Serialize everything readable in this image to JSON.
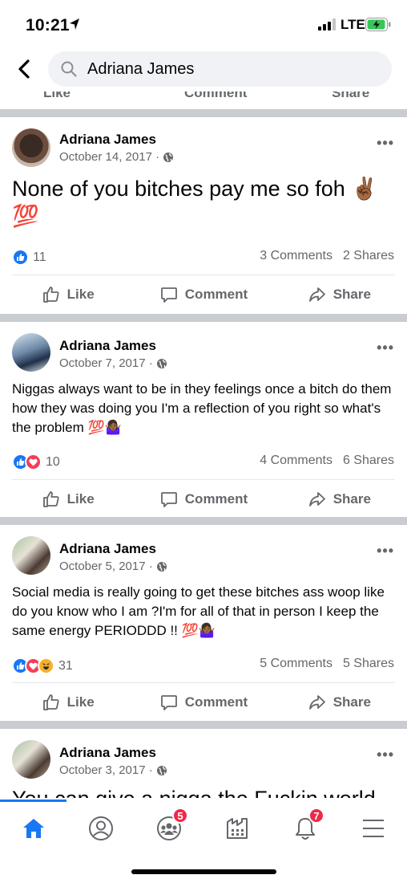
{
  "status_bar": {
    "time": "10:21",
    "network": "LTE"
  },
  "search": {
    "query": "Adriana James"
  },
  "previous_post_actions": {
    "like": "Like",
    "comment": "Comment",
    "share": "Share"
  },
  "posts": [
    {
      "author": "Adriana James",
      "date": "October 14, 2017 ·",
      "text": "None of you bitches pay me so foh ✌🏾 💯",
      "reaction_count": "11",
      "comments": "3 Comments",
      "shares": "2 Shares",
      "actions": {
        "like": "Like",
        "comment": "Comment",
        "share": "Share"
      }
    },
    {
      "author": "Adriana James",
      "date": "October 7, 2017 ·",
      "text": "Niggas always want to be in they feelings once a bitch do them how they was doing you I'm a reflection of you right so what's the problem 💯🤷🏾‍♀️",
      "reaction_count": "10",
      "comments": "4 Comments",
      "shares": "6 Shares",
      "actions": {
        "like": "Like",
        "comment": "Comment",
        "share": "Share"
      }
    },
    {
      "author": "Adriana James",
      "date": "October 5, 2017 ·",
      "text": "Social media is really going to get these bitches ass woop like do you know who I am ?I'm for all of that in person I keep the same energy PERIODDD !! 💯🤷🏾‍♀️",
      "reaction_count": "31",
      "comments": "5 Comments",
      "shares": "5 Shares",
      "actions": {
        "like": "Like",
        "comment": "Comment",
        "share": "Share"
      }
    },
    {
      "author": "Adriana James",
      "date": "October 3, 2017 ·",
      "text": "You can give a nigga the Fuckin world"
    }
  ],
  "tabbar": {
    "items": [
      {
        "icon": "home-icon",
        "badge": ""
      },
      {
        "icon": "profile-icon",
        "badge": ""
      },
      {
        "icon": "groups-icon",
        "badge": "5"
      },
      {
        "icon": "marketplace-icon",
        "badge": ""
      },
      {
        "icon": "notifications-icon",
        "badge": "7"
      },
      {
        "icon": "menu-icon",
        "badge": ""
      }
    ]
  },
  "colors": {
    "accent": "#1877f2",
    "secondary_text": "#65676b",
    "divider": "#c9ccd1",
    "badge": "#f02849",
    "love": "#f33e58",
    "haha": "#f7b125"
  }
}
